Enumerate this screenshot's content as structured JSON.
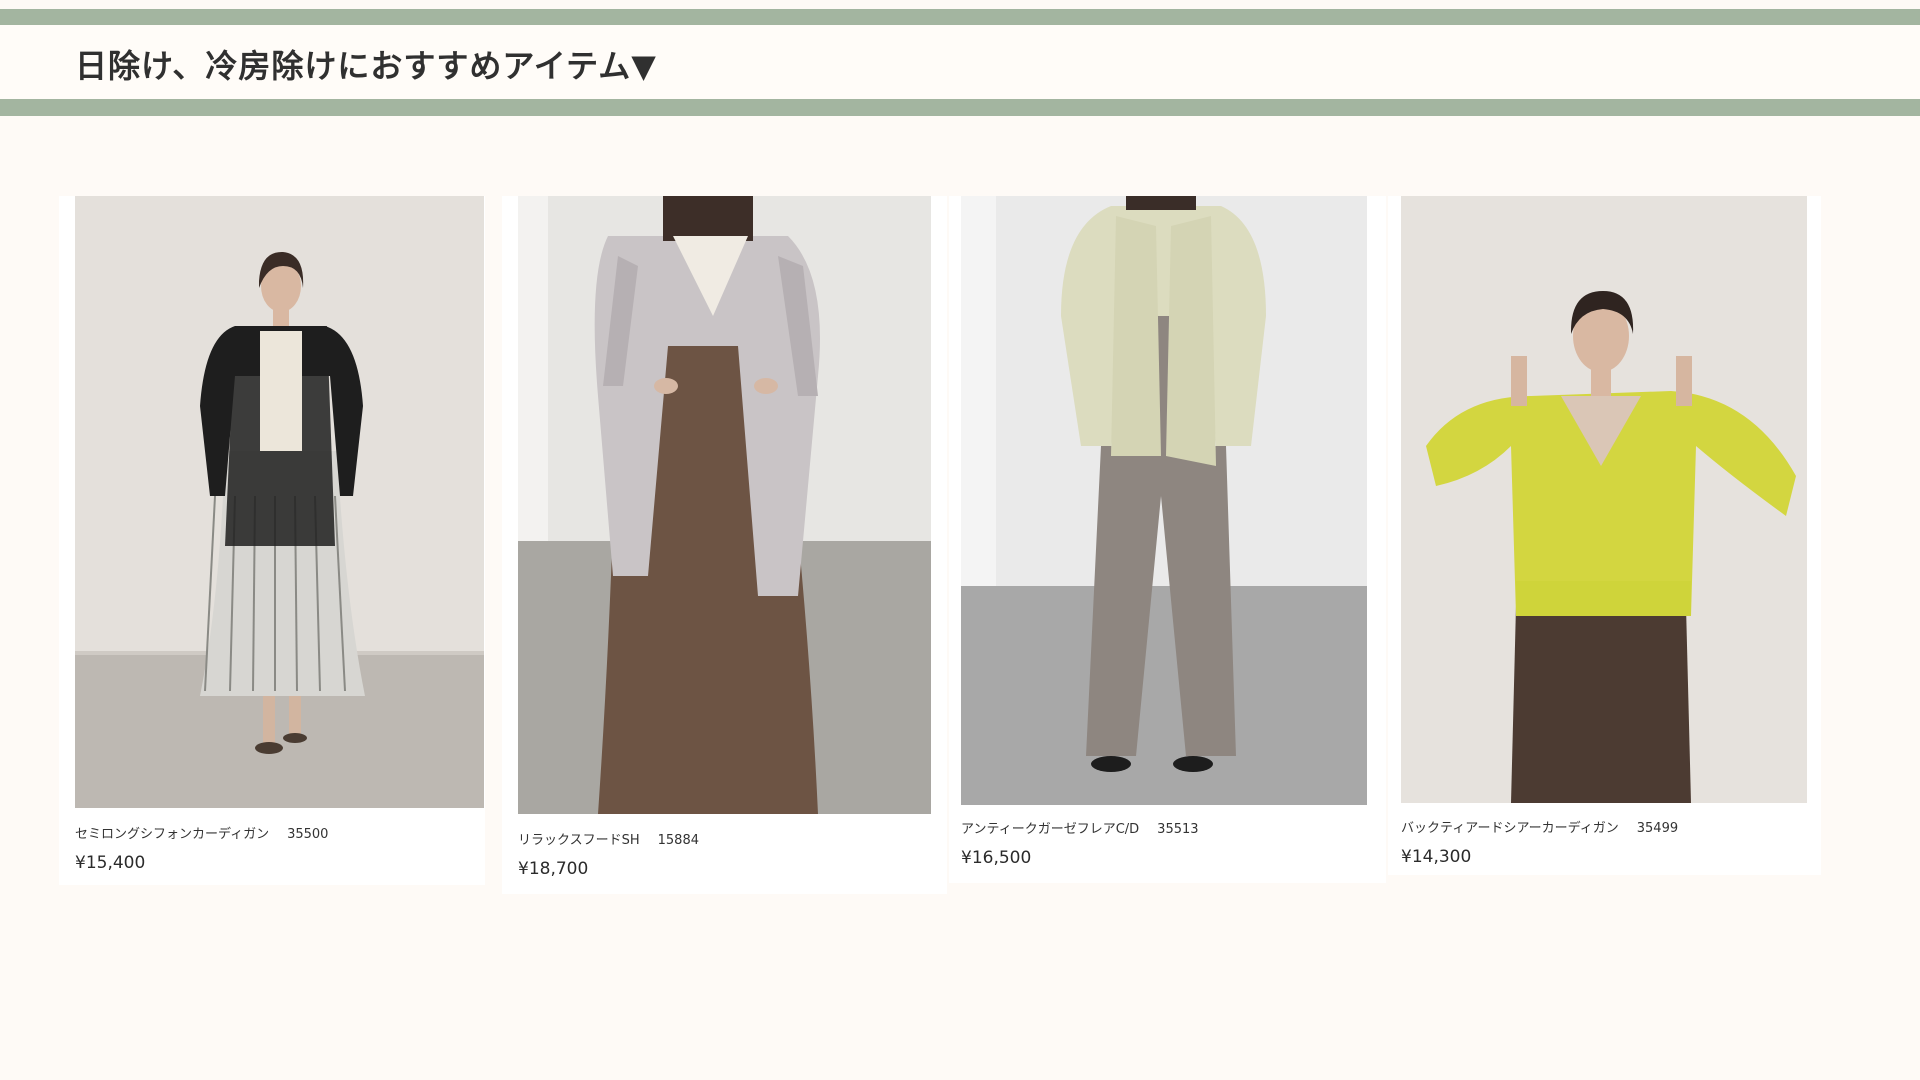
{
  "section": {
    "title": "日除け、冷房除けにおすすめアイテム▼"
  },
  "products": [
    {
      "name": "セミロングシフォンカーディガン",
      "code": "35500",
      "price": "¥15,400",
      "photo_icon": "model-black-cardigan-photo",
      "garment_color": "#1e1e1e"
    },
    {
      "name": "リラックスフードSH",
      "code": "15884",
      "price": "¥18,700",
      "photo_icon": "model-hooded-shirt-photo",
      "garment_color": "#c9c4c6"
    },
    {
      "name": "アンティークガーゼフレアC/D",
      "code": "35513",
      "price": "¥16,500",
      "photo_icon": "model-gauze-cardigan-photo",
      "garment_color": "#dcdcbf"
    },
    {
      "name": "バックティアードシアーカーディガン",
      "code": "35499",
      "price": "¥14,300",
      "photo_icon": "model-yellow-sheer-cardigan-photo",
      "garment_color": "#d3d640"
    }
  ],
  "colors": {
    "page_background": "#fefaf6",
    "band": "#a3b5a0",
    "card_background": "#ffffff"
  }
}
